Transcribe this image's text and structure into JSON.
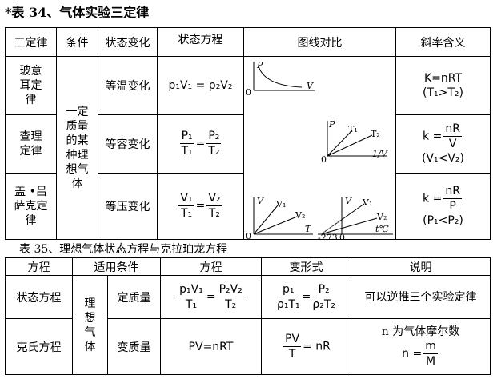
{
  "table34": {
    "title": "*表 34、气体实验三定律",
    "headers": [
      "三定律",
      "条件",
      "状态变化",
      "状态方程",
      "图线对比",
      "斜率含义"
    ],
    "condition": "一定质量的某种理想气体",
    "rows": [
      {
        "law": "玻意耳定律",
        "change": "等温变化",
        "eq": "p₁V₁ = p₂V₂",
        "k_line1": "K=nRT",
        "k_line2": "(T₁>T₂)"
      },
      {
        "law": "查理定律",
        "change": "等容变化",
        "eq_num1": "P₁",
        "eq_den1": "T₁",
        "eq_num2": "P₂",
        "eq_den2": "T₂",
        "k_prefix": "k =",
        "k_num": "nR",
        "k_den": "V",
        "k_line2": "(V₁<V₂)"
      },
      {
        "law": "盖 •吕萨克定律",
        "change": "等压变化",
        "eq_num1": "V₁",
        "eq_den1": "T₁",
        "eq_num2": "V₂",
        "eq_den2": "T₂",
        "k_prefix": "k =",
        "k_num": "nR",
        "k_den": "P",
        "k_line2": "(P₁<P₂)"
      }
    ],
    "graph_labels": {
      "p": "P",
      "v": "V",
      "t": "T",
      "zero": "0",
      "inv_v": "1/V",
      "t1": "T₁",
      "t2": "T₂",
      "v1": "V₁",
      "v2": "V₂",
      "p1": "P₁",
      "p2": "P₂",
      "neg273": "-273",
      "tc": "t℃"
    }
  },
  "table35": {
    "title": "表 35、理想气体状态方程与克拉珀龙方程",
    "headers": [
      "方程",
      "适用条件",
      "方程",
      "变形式",
      "说明"
    ],
    "condition": "理想气体",
    "rows": [
      {
        "name": "状态方程",
        "cond": "定质量",
        "eq_num1": "p₁V₁",
        "eq_den1": "T₁",
        "eq_num2": "P₂V₂",
        "eq_den2": "T₂",
        "var_num1": "p₁",
        "var_den1": "ρ₁T₁",
        "var_num2": "P₂",
        "var_den2": "ρ₂T₂",
        "note": "可以逆推三个实验定律"
      },
      {
        "name": "克氏方程",
        "cond": "变质量",
        "eq": "PV=nRT",
        "var_pv": "PV",
        "var_t": "T",
        "var_rest": "= nR",
        "note_line1": "n 为气体摩尔数",
        "n_prefix": "n =",
        "n_num": "m",
        "n_den": "M"
      }
    ]
  }
}
